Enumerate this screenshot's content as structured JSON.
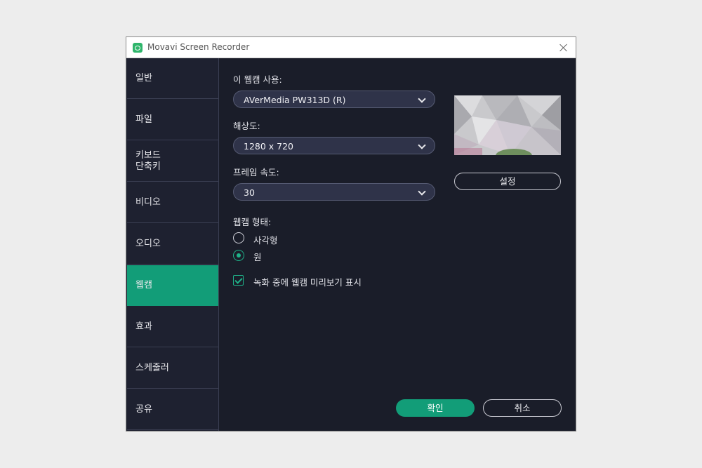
{
  "window": {
    "title": "Movavi Screen Recorder"
  },
  "sidebar": {
    "items": [
      {
        "label": "일반"
      },
      {
        "label": "파일"
      },
      {
        "label": "키보드\n단축키"
      },
      {
        "label": "비디오"
      },
      {
        "label": "오디오"
      },
      {
        "label": "웹캠",
        "active": true
      },
      {
        "label": "효과"
      },
      {
        "label": "스케줄러"
      },
      {
        "label": "공유"
      }
    ]
  },
  "webcam": {
    "use_label": "이 웹캠 사용:",
    "device": "AVerMedia PW313D (R)",
    "resolution_label": "해상도:",
    "resolution": "1280 x 720",
    "framerate_label": "프레임 속도:",
    "framerate": "30",
    "shape_label": "웹캠 형태:",
    "shape_options": [
      {
        "label": "사각형",
        "selected": false
      },
      {
        "label": "원",
        "selected": true
      }
    ],
    "preview_checkbox_label": "녹화 중에 웹캠 미리보기 표시",
    "preview_checked": true,
    "settings_button": "설정"
  },
  "footer": {
    "ok": "확인",
    "cancel": "취소"
  },
  "colors": {
    "accent": "#129d78",
    "background": "#1a1d29",
    "sidebar": "#1e2130"
  }
}
